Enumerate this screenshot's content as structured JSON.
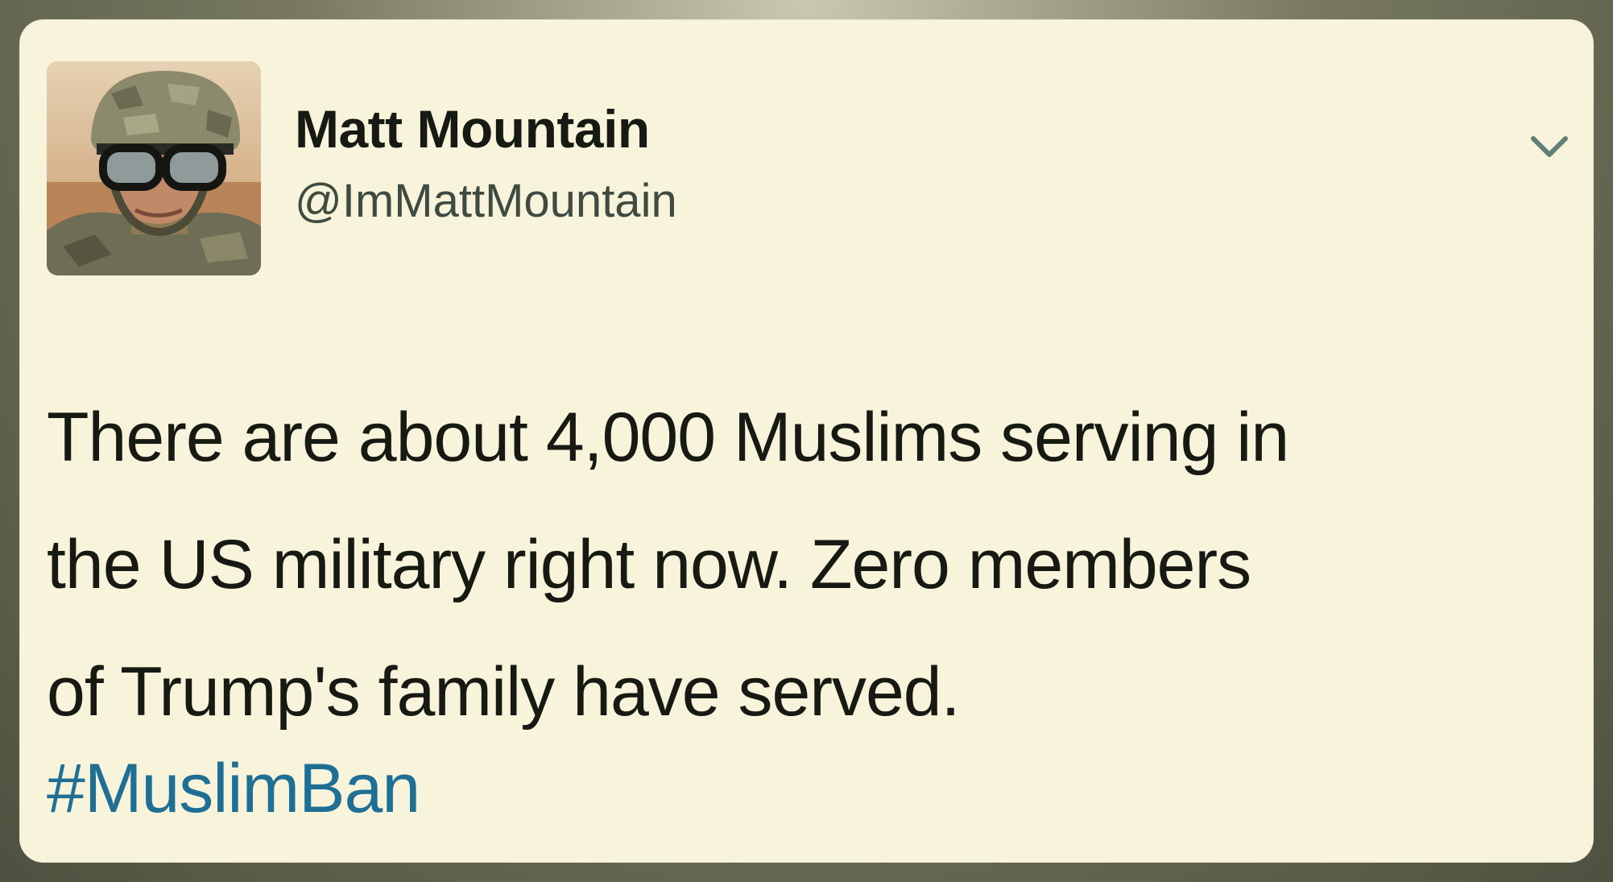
{
  "tweet": {
    "author_name": "Matt Mountain",
    "author_handle": "@ImMattMountain",
    "text_lines": [
      "There are about 4,000 Muslims serving in",
      "the US military right now. Zero members",
      "of Trump's family have served."
    ],
    "hashtag": "#MuslimBan"
  },
  "icons": {
    "avatar": "profile-photo-soldier-helmet-goggles",
    "menu": "chevron-down-icon"
  },
  "colors": {
    "card_background": "#f8f4dc",
    "text": "#161a12",
    "handle": "#3f4a40",
    "hashtag": "#1e6f93",
    "chevron": "#5f7f77"
  }
}
